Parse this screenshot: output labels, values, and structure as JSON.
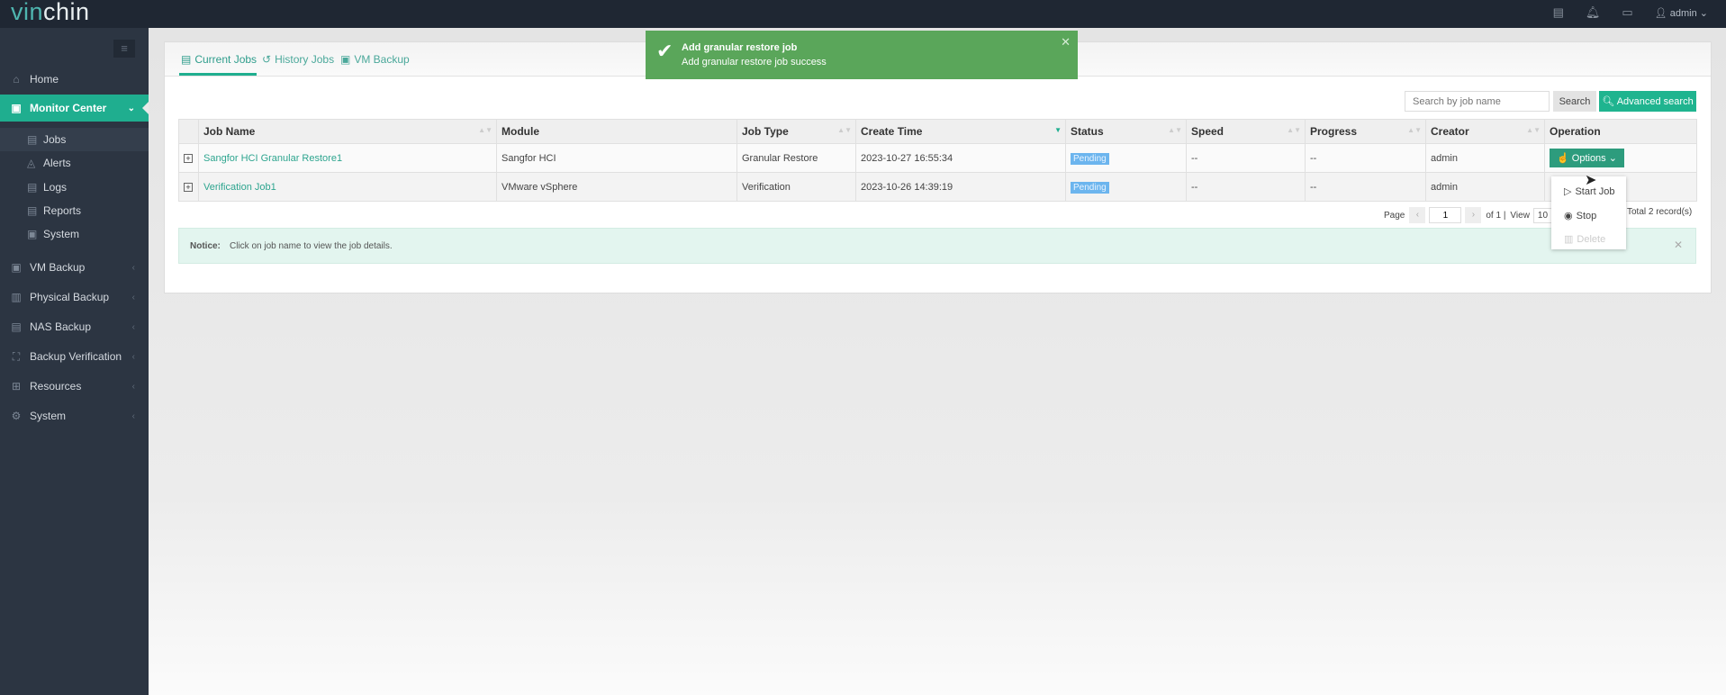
{
  "brand": {
    "logo_a": "vin",
    "logo_b": "chin"
  },
  "topbar": {
    "user": "admin",
    "icons": [
      "server-icon",
      "bell-icon",
      "monitor-icon",
      "user-icon"
    ]
  },
  "sidebar": {
    "items": [
      {
        "label": "Home",
        "icon": "home-icon"
      },
      {
        "label": "Monitor Center",
        "icon": "monitor-icon",
        "active": true
      },
      {
        "label": "VM Backup",
        "icon": "vm-icon"
      },
      {
        "label": "Physical Backup",
        "icon": "server-icon"
      },
      {
        "label": "NAS Backup",
        "icon": "nas-icon"
      },
      {
        "label": "Backup Verification",
        "icon": "verify-icon"
      },
      {
        "label": "Resources",
        "icon": "grid-icon"
      },
      {
        "label": "System",
        "icon": "gear-icon"
      }
    ],
    "sub": [
      {
        "label": "Jobs",
        "active": true
      },
      {
        "label": "Alerts"
      },
      {
        "label": "Logs"
      },
      {
        "label": "Reports"
      },
      {
        "label": "System"
      }
    ]
  },
  "tabs": [
    {
      "label": "Current Jobs",
      "active": true
    },
    {
      "label": "History Jobs"
    },
    {
      "label": "VM Backup"
    }
  ],
  "toast": {
    "title": "Add granular restore job",
    "message": "Add granular restore job success",
    "color": "#5aa65a"
  },
  "search": {
    "placeholder": "Search by job name",
    "button": "Search",
    "advanced": "Advanced search"
  },
  "table": {
    "columns": [
      "Job Name",
      "Module",
      "Job Type",
      "Create Time",
      "Status",
      "Speed",
      "Progress",
      "Creator",
      "Operation"
    ],
    "rows": [
      {
        "name": "Sangfor HCI Granular Restore1",
        "module": "Sangfor HCI",
        "type": "Granular Restore",
        "time": "2023-10-27 16:55:34",
        "status": "Pending",
        "speed": "--",
        "progress": "--",
        "creator": "admin",
        "op": "Options"
      },
      {
        "name": "Verification Job1",
        "module": "VMware vSphere",
        "type": "Verification",
        "time": "2023-10-26 14:39:19",
        "status": "Pending",
        "speed": "--",
        "progress": "--",
        "creator": "admin"
      }
    ]
  },
  "dropdown": [
    "Start Job",
    "Stop",
    "Delete"
  ],
  "pager": {
    "page_label": "Page",
    "page": "1",
    "of": "of 1 |",
    "view": "View",
    "view_value": "10",
    "total": "Total 2 record(s)"
  },
  "notice": {
    "label": "Notice:",
    "text": "Click on job name to view the job details."
  },
  "colors": {
    "accent": "#1fae8f",
    "sidebar": "#2c3542",
    "topbar": "#1f2733"
  }
}
